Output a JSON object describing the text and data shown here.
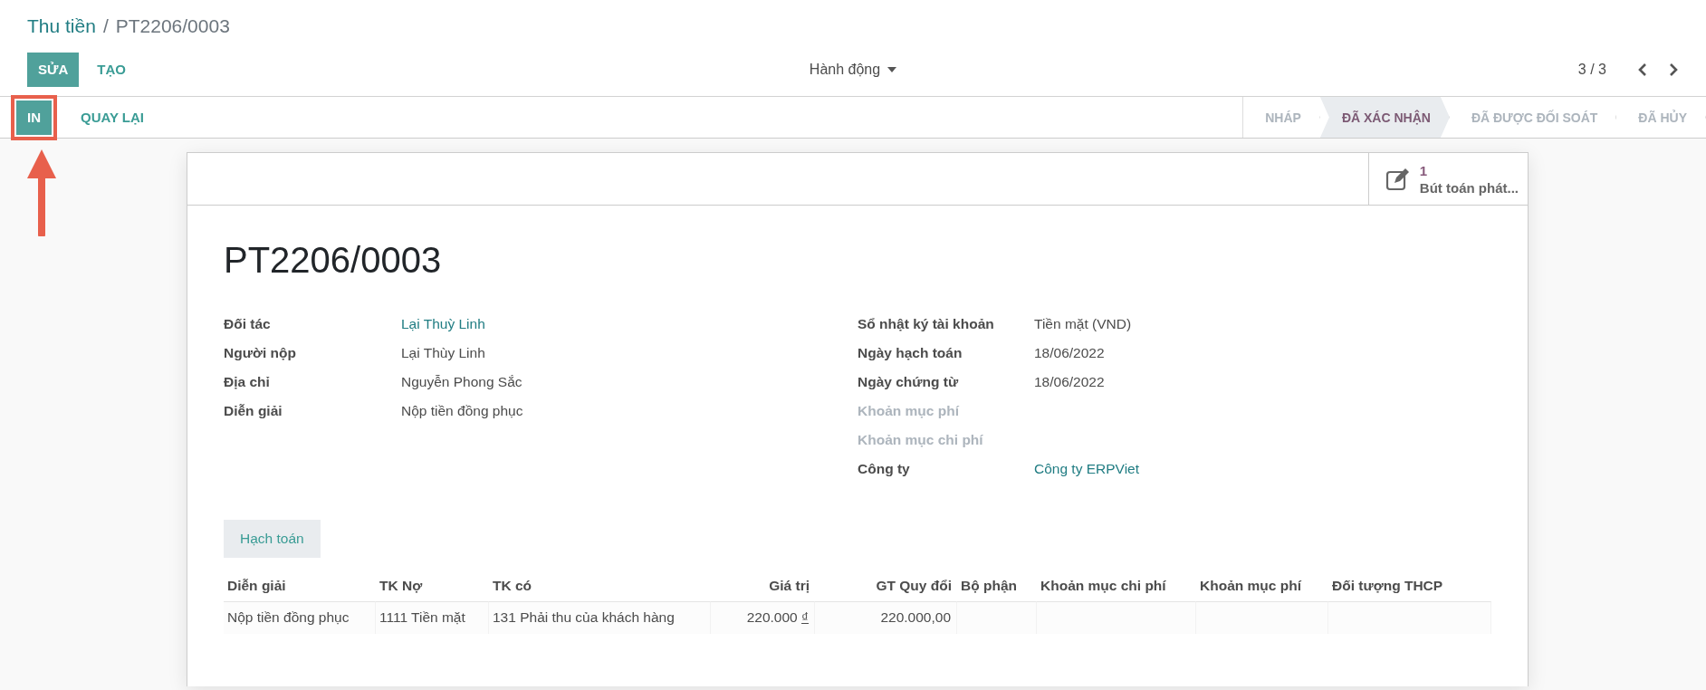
{
  "breadcrumb": {
    "parent": "Thu tiền",
    "separator": "/",
    "current": "PT2206/0003"
  },
  "toolbar": {
    "buttons": [
      {
        "label": "SỬA",
        "kind": "primary"
      },
      {
        "label": "TẠO",
        "kind": "link"
      }
    ],
    "action_menu": "Hành động",
    "pager": "3 / 3"
  },
  "form_buttons": [
    {
      "label": "IN",
      "kind": "primary",
      "highlighted": true
    },
    {
      "label": "QUAY LẠI",
      "kind": "link",
      "highlighted": false
    }
  ],
  "status_bar": [
    {
      "label": "NHÁP",
      "selected": false
    },
    {
      "label": "ĐÃ XÁC NHẬN",
      "selected": true
    },
    {
      "label": "ĐÃ ĐƯỢC ĐỐI SOÁT",
      "selected": false
    },
    {
      "label": "ĐÃ HỦY",
      "selected": false
    }
  ],
  "smart_button": {
    "count": "1",
    "label": "Bút toán phát..."
  },
  "title": "PT2206/0003",
  "left_fields": [
    {
      "label": "Đối tác",
      "value": "Lại Thuỳ Linh",
      "kind": "link",
      "muted": false
    },
    {
      "label": "Người nộp",
      "value": "Lại Thùy Linh",
      "kind": "text",
      "muted": false
    },
    {
      "label": "Địa chỉ",
      "value": "Nguyễn Phong Sắc",
      "kind": "text",
      "muted": false
    },
    {
      "label": "Diễn giải",
      "value": "Nộp tiền đồng phục",
      "kind": "text",
      "muted": false
    }
  ],
  "right_fields": [
    {
      "label": "Sổ nhật ký tài khoản",
      "value": "Tiền mặt (VND)",
      "kind": "text",
      "muted": false
    },
    {
      "label": "Ngày hạch toán",
      "value": "18/06/2022",
      "kind": "text",
      "muted": false
    },
    {
      "label": "Ngày chứng từ",
      "value": "18/06/2022",
      "kind": "text",
      "muted": false
    },
    {
      "label": "Khoản mục phí",
      "muted": true
    },
    {
      "label": "Khoản mục chi phí",
      "muted": true
    },
    {
      "label": "Công ty",
      "value": "Công ty ERPViet",
      "kind": "link",
      "muted": false
    }
  ],
  "tabs": [
    {
      "label": "Hạch toán",
      "selected": true
    }
  ],
  "table": {
    "columns": [
      {
        "label": "Diễn giải",
        "kind": "text"
      },
      {
        "label": "TK Nợ",
        "kind": "text"
      },
      {
        "label": "TK có",
        "kind": "text"
      },
      {
        "label": "Giá trị",
        "kind": "amount"
      },
      {
        "label": "GT Quy đổi",
        "kind": "amount"
      },
      {
        "label": "Bộ phận",
        "kind": "text"
      },
      {
        "label": "Khoản mục chi phí",
        "kind": "text"
      },
      {
        "label": "Khoản mục phí",
        "kind": "text"
      },
      {
        "label": "Đối tượng THCP",
        "kind": "text"
      }
    ],
    "rows": [
      {
        "cells": [
          "Nộp tiền đồng phục",
          "1111 Tiền mặt",
          "131 Phải thu của khách hàng",
          "220.000 ₫",
          "220.000,00",
          "",
          "",
          "",
          ""
        ]
      }
    ]
  }
}
